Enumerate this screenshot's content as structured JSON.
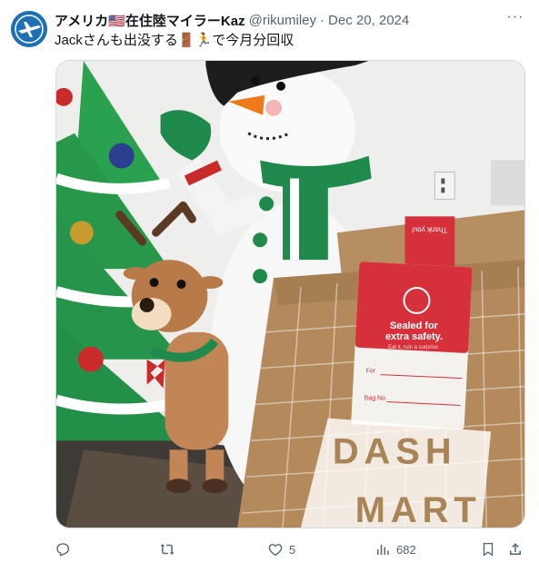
{
  "tweet": {
    "display_name": "アメリカ🇺🇸在住陸マイラーKaz",
    "handle": "@rikumiley",
    "separator": "·",
    "date": "Dec 20, 2024",
    "text": "Jackさんも出没する🚪🏃で今月分回収",
    "more": "···"
  },
  "image": {
    "bag_label_line1": "Sealed for",
    "bag_label_line2": "extra safety.",
    "bag_label_small": "Eat it, ruin a surprise",
    "field_for": "For",
    "field_bag": "Bag No.",
    "top_tag": "Thank you!",
    "dash_line1": "DASH",
    "dash_line2": "MART"
  },
  "actions": {
    "reply_count": "",
    "retweet_count": "",
    "like_count": "5",
    "view_count": "682"
  },
  "icons": {
    "reply": "reply-icon",
    "retweet": "retweet-icon",
    "like": "heart-icon",
    "views": "views-icon",
    "bookmark": "bookmark-icon",
    "share": "share-icon"
  }
}
